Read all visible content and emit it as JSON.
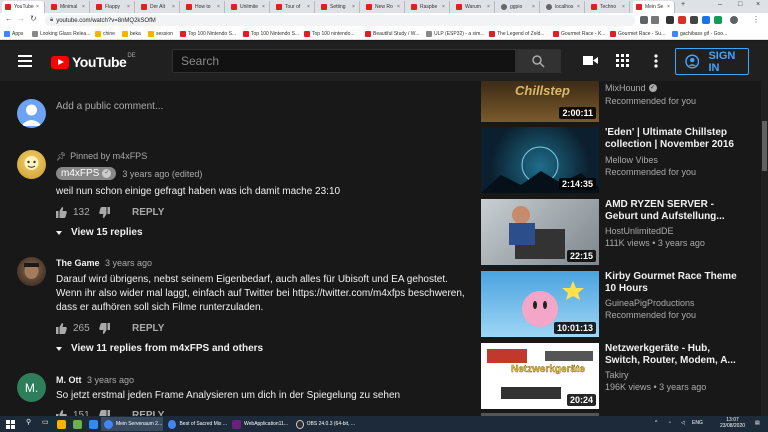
{
  "browser": {
    "tabs": [
      {
        "title": "YouTube",
        "icon": "youtube-icon"
      },
      {
        "title": "Minimal",
        "icon": "youtube-icon"
      },
      {
        "title": "Flappy",
        "icon": "youtube-icon"
      },
      {
        "title": "Der Alt",
        "icon": "youtube-icon"
      },
      {
        "title": "How to",
        "icon": "youtube-icon"
      },
      {
        "title": "Unlimite",
        "icon": "youtube-icon"
      },
      {
        "title": "Tour of",
        "icon": "youtube-icon"
      },
      {
        "title": "Setting",
        "icon": "youtube-icon"
      },
      {
        "title": "New Ro",
        "icon": "youtube-icon"
      },
      {
        "title": "Raspbe",
        "icon": "youtube-icon"
      },
      {
        "title": "Warum",
        "icon": "youtube-icon"
      },
      {
        "title": "ggpio",
        "icon": "globe-icon"
      },
      {
        "title": "localhos",
        "icon": "globe-icon"
      },
      {
        "title": "Techno",
        "icon": "youtube-icon"
      },
      {
        "title": "Mein Se",
        "icon": "youtube-icon"
      }
    ],
    "url": "youtube.com/watch?v=8nMQ2kSOfM",
    "bookmarks": [
      "Apps",
      "Looking Glass Relea...",
      "chine",
      "beka",
      "session",
      "Top 100 Nintendo S...",
      "Top 100 Nintendo S...",
      "Top 100 nintendo...",
      "Beautiful Study / W...",
      "ULP (ESP32) - a sim...",
      "The Legend of Zeld...",
      "Gourmet Race - K...",
      "Gourmet Race - Su...",
      "gachibass gif - Goo..."
    ]
  },
  "header": {
    "logo_text": "YouTube",
    "country": "DE",
    "search_placeholder": "Search",
    "signin_label": "SIGN IN"
  },
  "comments": {
    "add_placeholder": "Add a public comment...",
    "items": [
      {
        "pinned": "Pinned by m4xFPS",
        "author": "m4xFPS",
        "time": "3 years ago (edited)",
        "text": "weil nun schon einige gefragt haben was ich damit mache 23:10",
        "likes": "132",
        "reply": "REPLY",
        "view_replies": "View 15 replies"
      },
      {
        "author": "The Game",
        "time": "3 years ago",
        "text": "Darauf wird übrigens, nebst seinem Eigenbedarf, auch alles für Ubisoft und EA gehostet. Wenn ihr also wider mal laggt, einfach auf Twitter bei https://twitter.com/m4xfps beschweren, dass er aufhören soll sich Filme runterzuladen.",
        "likes": "265",
        "reply": "REPLY",
        "view_replies": "View 11 replies from m4xFPS and others"
      },
      {
        "author": "M. Ott",
        "avatar_letter": "M.",
        "time": "3 years ago",
        "text": "So jetzt erstmal jeden Frame Analysieren um dich in der Spiegelung zu sehen",
        "likes": "151",
        "reply": "REPLY"
      }
    ]
  },
  "videos": [
    {
      "title": "",
      "channel": "MixHound",
      "meta": "Recommended for you",
      "duration": "2:00:11",
      "thumb_text": "Chillstep"
    },
    {
      "title": "'Eden' | Ultimate Chillstep collection | November 2016",
      "channel": "Mellow Vibes",
      "meta": "Recommended for you",
      "duration": "2:14:35"
    },
    {
      "title": "AMD RYZEN SERVER - Geburt und Aufstellung...",
      "channel": "HostUnlimitedDE",
      "meta": "111K views • 3 years ago",
      "duration": "22:15"
    },
    {
      "title": "Kirby Gourmet Race Theme 10 Hours",
      "channel": "GuineaPigProductions",
      "meta": "Recommended for you",
      "duration": "10:01:13"
    },
    {
      "title": "Netzwerkgeräte - Hub, Switch, Router, Modem, A...",
      "channel": "Takiry",
      "meta": "196K views • 3 years ago",
      "duration": "20:24",
      "thumb_text": "Netzwerkgeräte"
    }
  ],
  "taskbar": {
    "items": [
      "Mein Servenaum 2...",
      "Best of Sacred Mix ...",
      "WebApplication11...",
      "OBS 24.0.3 (64-bit, ..."
    ],
    "lang": "ENG",
    "time": "13:07",
    "date": "23/08/2020"
  },
  "colors": {
    "accent": "#3ea6ff",
    "youtube_red": "#ff0000",
    "background": "#181818"
  }
}
